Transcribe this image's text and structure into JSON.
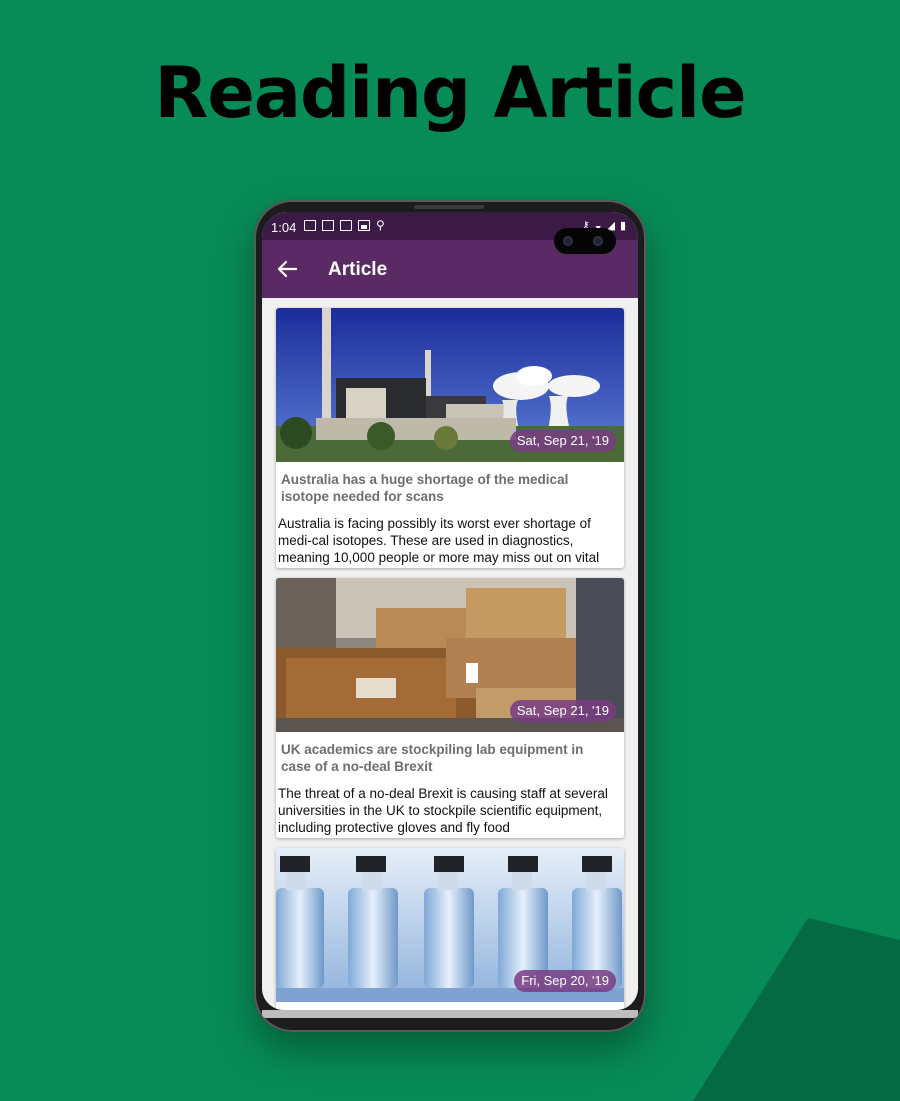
{
  "headline": "Reading Article",
  "status_bar": {
    "time": "1:04"
  },
  "toolbar": {
    "title": "Article"
  },
  "articles": [
    {
      "date": "Sat, Sep 21, '19",
      "title": "Australia has a huge shortage of the medical isotope needed for scans",
      "summary": "Australia is facing possibly its worst ever shortage of medi-cal isotopes. These are used in diagnostics, meaning 10,000 people or more may miss out on vital diagnostic scans",
      "image": "power-plant-photo"
    },
    {
      "date": "Sat, Sep 21, '19",
      "title": "UK academics are stockpiling lab equipment in case of a no-deal Brexit",
      "summary": "The threat of a no-deal Brexit is causing staff at several universities in the UK to stockpile scientific equipment, including protective gloves and fly food",
      "image": "cardboard-boxes-photo"
    },
    {
      "date": "Fri, Sep 20, '19",
      "image": "vials-photo"
    }
  ],
  "colors": {
    "background": "#078c57",
    "status_bar": "#3b1a45",
    "toolbar": "#5a2a64",
    "badge": "#7a3c82"
  }
}
